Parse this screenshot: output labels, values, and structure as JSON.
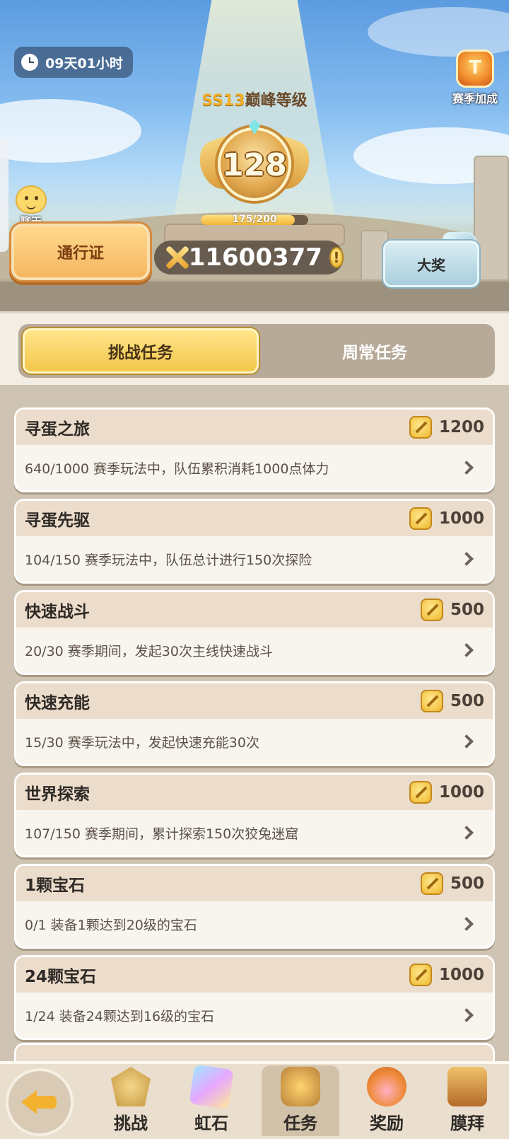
{
  "header": {
    "timer": "09天01小时",
    "season_bonus_label": "赛季加成",
    "rank_prefix": "SS13",
    "rank_title": "巅峰等级",
    "level": "128",
    "progress_text": "175/200",
    "progress_value": 0.875,
    "chat_label": "聊天",
    "pass_button": "通行证",
    "points": "11600377",
    "info_symbol": "!",
    "grand_prize_button": "大奖"
  },
  "tabs": [
    {
      "label": "挑战任务",
      "active": true
    },
    {
      "label": "周常任务",
      "active": false
    }
  ],
  "tasks": [
    {
      "title": "寻蛋之旅",
      "reward": "1200",
      "desc": "640/1000 赛季玩法中，队伍累积消耗1000点体力"
    },
    {
      "title": "寻蛋先驱",
      "reward": "1000",
      "desc": "104/150 赛季玩法中，队伍总计进行150次探险"
    },
    {
      "title": "快速战斗",
      "reward": "500",
      "desc": "20/30 赛季期间，发起30次主线快速战斗"
    },
    {
      "title": "快速充能",
      "reward": "500",
      "desc": "15/30 赛季玩法中，发起快速充能30次"
    },
    {
      "title": "世界探索",
      "reward": "1000",
      "desc": "107/150 赛季期间，累计探索150次狡兔迷窟"
    },
    {
      "title": "1颗宝石",
      "reward": "500",
      "desc": "0/1 装备1颗达到20级的宝石"
    },
    {
      "title": "24颗宝石",
      "reward": "1000",
      "desc": "1/24 装备24颗达到16级的宝石"
    }
  ],
  "bottom_nav": [
    {
      "label": "挑战",
      "icon": "challenge-icon"
    },
    {
      "label": "虹石",
      "icon": "rainbow-stone-icon"
    },
    {
      "label": "任务",
      "icon": "task-icon",
      "active": true
    },
    {
      "label": "奖励",
      "icon": "reward-icon"
    },
    {
      "label": "膜拜",
      "icon": "worship-icon"
    }
  ],
  "colors": {
    "accent_gold": "#f2c64a",
    "panel_bg": "#cfc4b3",
    "card_header": "#ecdccb"
  }
}
